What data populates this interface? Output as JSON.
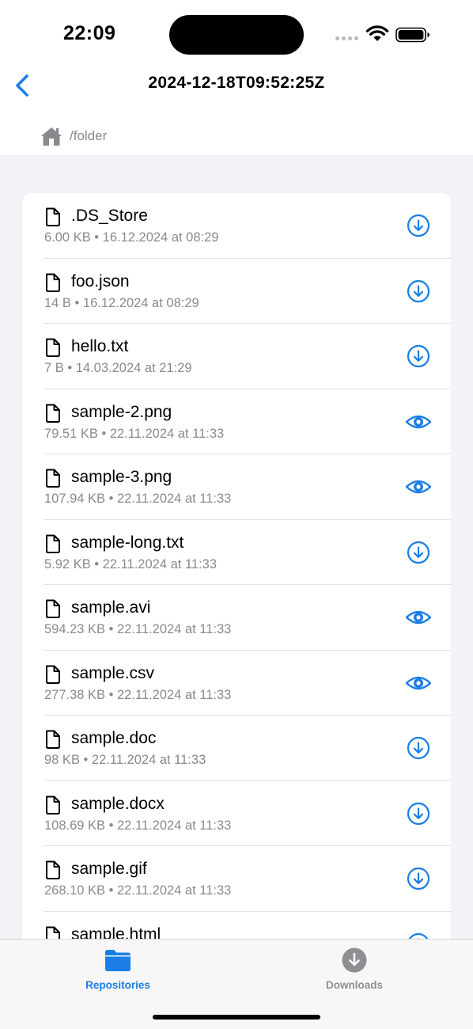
{
  "status_bar": {
    "time": "22:09"
  },
  "nav": {
    "title": "2024-12-18T09:52:25Z",
    "back_icon": "chevron-left-icon"
  },
  "breadcrumb": {
    "icon": "home-icon",
    "path": "/folder"
  },
  "colors": {
    "accent": "#1a7ee6",
    "secondary_text": "#8a8a8e",
    "background": "#f2f2f7",
    "inactive_tab": "#8e8e93"
  },
  "files": [
    {
      "name": ".DS_Store",
      "meta": "6.00 KB • 16.12.2024 at 08:29",
      "action": "download"
    },
    {
      "name": "foo.json",
      "meta": "14 B • 16.12.2024 at 08:29",
      "action": "download"
    },
    {
      "name": "hello.txt",
      "meta": "7 B • 14.03.2024 at 21:29",
      "action": "download"
    },
    {
      "name": "sample-2.png",
      "meta": "79.51 KB • 22.11.2024 at 11:33",
      "action": "view"
    },
    {
      "name": "sample-3.png",
      "meta": "107.94 KB • 22.11.2024 at 11:33",
      "action": "view"
    },
    {
      "name": "sample-long.txt",
      "meta": "5.92 KB • 22.11.2024 at 11:33",
      "action": "download"
    },
    {
      "name": "sample.avi",
      "meta": "594.23 KB • 22.11.2024 at 11:33",
      "action": "view"
    },
    {
      "name": "sample.csv",
      "meta": "277.38 KB • 22.11.2024 at 11:33",
      "action": "view"
    },
    {
      "name": "sample.doc",
      "meta": "98 KB • 22.11.2024 at 11:33",
      "action": "download"
    },
    {
      "name": "sample.docx",
      "meta": "108.69 KB • 22.11.2024 at 11:33",
      "action": "download"
    },
    {
      "name": "sample.gif",
      "meta": "268.10 KB • 22.11.2024 at 11:33",
      "action": "download"
    },
    {
      "name": "sample.html",
      "meta": "",
      "action": "download"
    }
  ],
  "tabs": [
    {
      "label": "Repositories",
      "icon": "folder-icon",
      "active": true
    },
    {
      "label": "Downloads",
      "icon": "download-circle-icon",
      "active": false
    }
  ]
}
